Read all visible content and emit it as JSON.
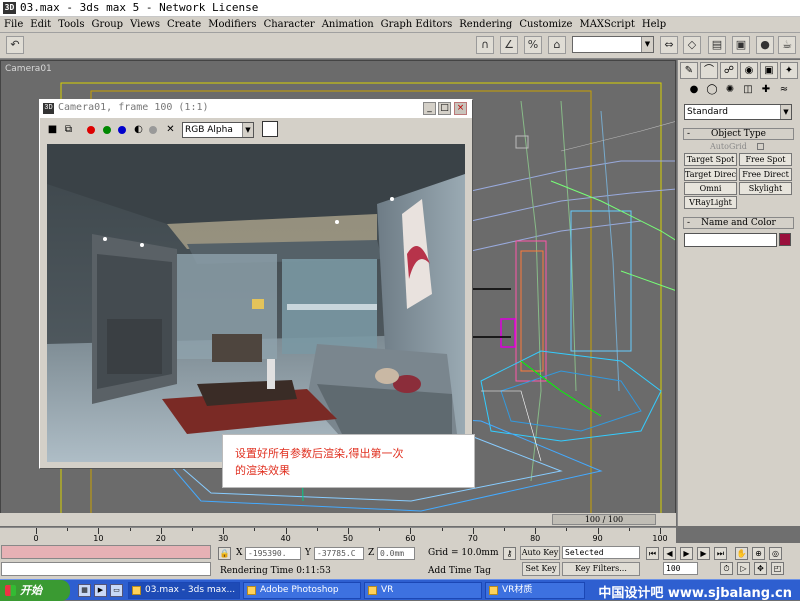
{
  "window": {
    "title": "03.max - 3ds max 5 - Network License"
  },
  "menu": [
    "File",
    "Edit",
    "Tools",
    "Group",
    "Views",
    "Create",
    "Modifiers",
    "Character",
    "Animation",
    "Graph Editors",
    "Rendering",
    "Customize",
    "MAXScript",
    "Help"
  ],
  "toolbar": {
    "selection_combo": ""
  },
  "viewport": {
    "label": "Camera01"
  },
  "camera_window": {
    "title": "Camera01, frame 100 (1:1)",
    "channel": "RGB Alpha",
    "buttons": {
      "minimize": "_",
      "maximize": "□",
      "close": "×"
    }
  },
  "command_panel": {
    "category": "Standard",
    "object_type_title": "Object Type",
    "autogrid": "AutoGrid",
    "object_buttons": [
      "Target Spot",
      "Free Spot",
      "Target Direct",
      "Free Direct",
      "Omni",
      "Skylight",
      "VRayLight"
    ],
    "name_color_title": "Name and Color",
    "accent_color": "#9a0f3c"
  },
  "timeline": {
    "frame_counter": "100 / 100",
    "ticks": [
      "0",
      "10",
      "20",
      "30",
      "40",
      "50",
      "60",
      "70",
      "80",
      "90",
      "100"
    ]
  },
  "status": {
    "x_label": "X",
    "x_value": "-195390.",
    "y_label": "Y",
    "y_value": "-37785.C",
    "z_label": "Z",
    "z_value": "0.0mm",
    "grid": "Grid = 10.0mm",
    "auto_key": "Auto Key",
    "selected": "Selected",
    "set_key": "Set Key",
    "key_filters": "Key Filters...",
    "frame": "100",
    "rendering_time": "Rendering Time  0:11:53",
    "add_time_tag": "Add Time Tag"
  },
  "annotation": {
    "line1": "设置好所有参数后渲染,得出第一次",
    "line2": "的渲染效果"
  },
  "taskbar": {
    "start": "开始",
    "tasks": [
      "03.max - 3ds max...",
      "Adobe Photoshop",
      "VR",
      "VR材质"
    ],
    "watermark": "中国设计吧 www.sjbalang.cn"
  }
}
